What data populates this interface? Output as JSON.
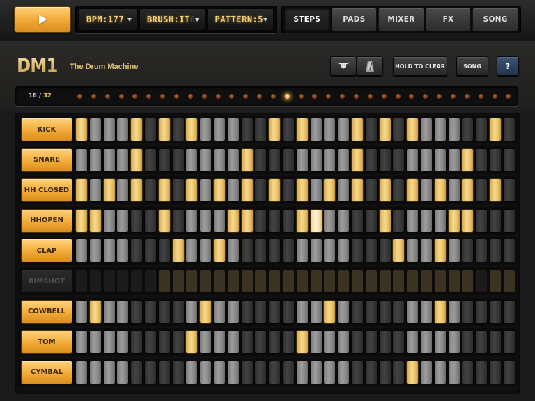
{
  "toolbar": {
    "play_icon": "play-icon",
    "lcds": [
      {
        "text": "BPM:177",
        "ghost": "",
        "name": "bpm-selector"
      },
      {
        "text": "BRUSH:IT",
        "ghost": "8",
        "name": "kit-selector"
      },
      {
        "text": "PATTERN:5",
        "ghost": "",
        "name": "pattern-selector"
      }
    ],
    "tabs": [
      {
        "label": "STEPS",
        "active": true
      },
      {
        "label": "PADS",
        "active": false
      },
      {
        "label": "MIXER",
        "active": false
      },
      {
        "label": "FX",
        "active": false
      },
      {
        "label": "SONG",
        "active": false
      }
    ]
  },
  "header": {
    "logo": "DM1",
    "subtitle": "The Drum Machine",
    "buttons": {
      "hold_to_clear": "HOLD TO CLEAR",
      "song": "SONG",
      "help": "?"
    },
    "icons": [
      "bull-icon",
      "metronome-icon"
    ]
  },
  "position": {
    "current": "16",
    "separator": "/",
    "total": "32",
    "led_count": 32,
    "active_led": 16
  },
  "colors": {
    "accent": "#f0a733",
    "step_on": "#f2d17c",
    "led_on": "#ffb84a"
  },
  "step_pattern_legend": {
    "1": "on",
    "0": "off",
    "2": "on-playing",
    "3": "muted-on"
  },
  "tracks": [
    {
      "name": "KICK",
      "muted": false,
      "steps": [
        1,
        0,
        0,
        0,
        1,
        0,
        1,
        0,
        1,
        0,
        0,
        0,
        0,
        0,
        1,
        0,
        1,
        0,
        0,
        0,
        1,
        0,
        1,
        0,
        1,
        0,
        0,
        0,
        0,
        0,
        1,
        0
      ]
    },
    {
      "name": "SNARE",
      "muted": false,
      "steps": [
        0,
        0,
        0,
        0,
        1,
        0,
        0,
        0,
        0,
        0,
        0,
        0,
        1,
        0,
        0,
        0,
        0,
        0,
        0,
        0,
        1,
        0,
        0,
        0,
        0,
        0,
        0,
        0,
        1,
        0,
        0,
        0
      ]
    },
    {
      "name": "HH CLOSED",
      "muted": false,
      "steps": [
        1,
        0,
        1,
        0,
        1,
        0,
        1,
        0,
        1,
        0,
        1,
        0,
        1,
        0,
        1,
        0,
        1,
        0,
        1,
        0,
        1,
        0,
        1,
        0,
        1,
        0,
        1,
        0,
        1,
        0,
        1,
        0
      ]
    },
    {
      "name": "HHOPEN",
      "muted": false,
      "steps": [
        1,
        1,
        0,
        0,
        0,
        0,
        1,
        0,
        0,
        0,
        0,
        1,
        1,
        0,
        0,
        0,
        1,
        2,
        0,
        0,
        0,
        0,
        1,
        0,
        0,
        0,
        0,
        1,
        1,
        0,
        0,
        0
      ]
    },
    {
      "name": "CLAP",
      "muted": false,
      "steps": [
        0,
        0,
        0,
        0,
        0,
        0,
        0,
        1,
        0,
        0,
        1,
        0,
        0,
        0,
        0,
        0,
        0,
        0,
        0,
        0,
        0,
        0,
        0,
        1,
        0,
        0,
        1,
        0,
        0,
        0,
        0,
        0
      ]
    },
    {
      "name": "RIMSHOT",
      "muted": true,
      "steps": [
        0,
        0,
        0,
        0,
        0,
        0,
        3,
        3,
        3,
        3,
        3,
        3,
        3,
        3,
        3,
        3,
        3,
        3,
        3,
        3,
        3,
        3,
        3,
        3,
        3,
        3,
        3,
        3,
        3,
        0,
        3,
        3
      ]
    },
    {
      "name": "COWBELL",
      "muted": false,
      "steps": [
        0,
        1,
        0,
        0,
        0,
        0,
        0,
        0,
        0,
        1,
        0,
        0,
        0,
        0,
        0,
        0,
        0,
        0,
        1,
        0,
        0,
        0,
        0,
        0,
        0,
        0,
        1,
        0,
        0,
        0,
        0,
        0
      ]
    },
    {
      "name": "TOM",
      "muted": false,
      "steps": [
        0,
        0,
        0,
        0,
        0,
        0,
        0,
        0,
        1,
        0,
        0,
        0,
        0,
        0,
        0,
        0,
        1,
        0,
        0,
        0,
        0,
        0,
        0,
        0,
        0,
        0,
        0,
        0,
        0,
        0,
        0,
        0
      ]
    },
    {
      "name": "CYMBAL",
      "muted": false,
      "steps": [
        0,
        0,
        0,
        0,
        0,
        0,
        0,
        0,
        0,
        0,
        0,
        0,
        0,
        0,
        0,
        0,
        0,
        0,
        0,
        0,
        0,
        0,
        0,
        0,
        1,
        0,
        0,
        0,
        0,
        0,
        0,
        0
      ]
    }
  ]
}
